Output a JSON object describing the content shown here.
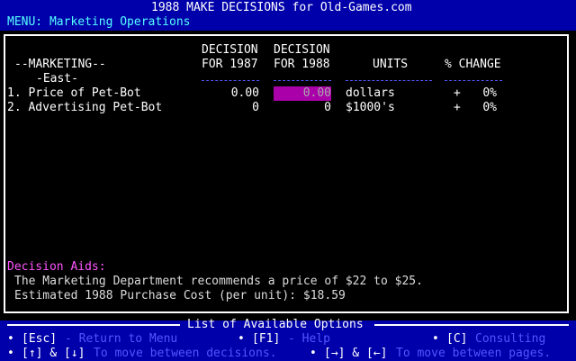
{
  "header": {
    "title": "1988 MAKE DECISIONS for Old-Games.com",
    "menu": "MENU: Marketing Operations"
  },
  "table": {
    "headers": {
      "decision_line": "DECISION",
      "decision_line2": "DECISION",
      "col1987": "FOR 1987",
      "col1988": "FOR 1988",
      "units": "UNITS",
      "pct": "% CHANGE",
      "section": "--MARKETING--",
      "region": "-East-"
    },
    "rows": [
      {
        "label": "1. Price of Pet-Bot",
        "v1987": "0.00",
        "v1988": "0.00",
        "units": "dollars",
        "sign": "+",
        "pct": "0%"
      },
      {
        "label": "2. Advertising Pet-Bot",
        "v1987": "0",
        "v1988": "0",
        "units": "$1000's",
        "sign": "+",
        "pct": "0%"
      }
    ]
  },
  "aids": {
    "title": "Decision Aids:",
    "line1": "The Marketing Department recommends a price of $22 to $25.",
    "line2": "Estimated 1988 Purchase Cost (per unit): $18.59"
  },
  "options": {
    "title": "List of Available Options",
    "bullet": "•",
    "esc_key": "[Esc]",
    "esc_text": "- Return to Menu",
    "f1_key": "[F1]",
    "f1_text": "- Help",
    "c_key": "[C]",
    "c_text": "Consulting",
    "updown_keys": "[↑] & [↓]",
    "updown_text": "To move between decisions.",
    "leftright_keys": "[→] & [←]",
    "leftright_text": "To move between pages."
  },
  "colors": {
    "background": "#0000aa",
    "panel": "#000000",
    "highlight": "#aa00aa",
    "accent_cyan": "#55ffff",
    "aids_title": "#ff55ff"
  }
}
